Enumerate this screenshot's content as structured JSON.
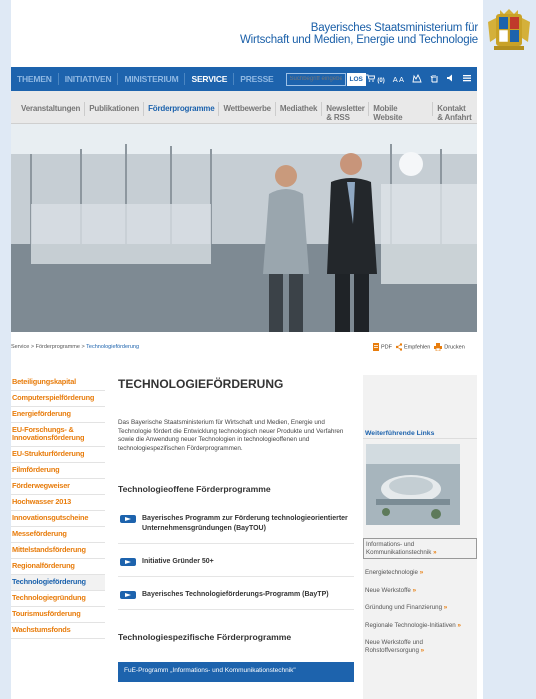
{
  "header": {
    "ministry_line1": "Bayerisches Staatsministerium für",
    "ministry_line2": "Wirtschaft und Medien, Energie und Technologie"
  },
  "topnav": {
    "items": [
      {
        "label": "THEMEN",
        "active": false
      },
      {
        "label": "INITIATIVEN",
        "active": false
      },
      {
        "label": "MINISTERIUM",
        "active": false
      },
      {
        "label": "SERVICE",
        "active": true
      },
      {
        "label": "PRESSE",
        "active": false
      }
    ],
    "search_placeholder": "Suchbegriff eingeben",
    "search_button": "LOS",
    "cart_count": "(0)",
    "font_size_label": "A A"
  },
  "subnav": {
    "items": [
      {
        "label": "Veranstaltungen",
        "active": false
      },
      {
        "label": "Publikationen",
        "active": false
      },
      {
        "label": "Förderprogramme",
        "active": true
      },
      {
        "label": "Wettbewerbe",
        "active": false
      },
      {
        "label": "Mediathek",
        "active": false
      },
      {
        "label": "Newsletter & RSS",
        "active": false
      },
      {
        "label": "Mobile Website",
        "active": false
      },
      {
        "label": "Kontakt & Anfahrt",
        "active": false
      }
    ]
  },
  "breadcrumb": {
    "items": [
      "Service",
      "Förderprogramme"
    ],
    "separator": ">",
    "current": "Technologieförderung"
  },
  "actions": {
    "pdf": "PDF",
    "recommend": "Empfehlen",
    "print": "Drucken"
  },
  "leftnav": {
    "items": [
      {
        "label": "Beteiligungskapital",
        "active": false
      },
      {
        "label": "Computerspielförderung",
        "active": false
      },
      {
        "label": "Energieförderung",
        "active": false
      },
      {
        "label": "EU-Forschungs- & Innovationsförderung",
        "active": false
      },
      {
        "label": "EU-Strukturförderung",
        "active": false
      },
      {
        "label": "Filmförderung",
        "active": false
      },
      {
        "label": "Förderwegweiser",
        "active": false
      },
      {
        "label": "Hochwasser 2013",
        "active": false
      },
      {
        "label": "Innovationsgutscheine",
        "active": false
      },
      {
        "label": "Messeförderung",
        "active": false
      },
      {
        "label": "Mittelstandsförderung",
        "active": false
      },
      {
        "label": "Regionalförderung",
        "active": false
      },
      {
        "label": "Technologieförderung",
        "active": true
      },
      {
        "label": "Technologiegründung",
        "active": false
      },
      {
        "label": "Tourismusförderung",
        "active": false
      },
      {
        "label": "Wachstumsfonds",
        "active": false
      }
    ]
  },
  "main": {
    "title": "TECHNOLOGIEFÖRDERUNG",
    "intro": "Das Bayerische Staatsministerium für Wirtschaft und Medien, Energie und Technologie fördert die Entwicklung technologisch neuer Produkte und Verfahren sowie die Anwendung neuer Technologien in technologieoffenen und technologiespezifischen Förderprogrammen.",
    "section1_title": "Technologieoffene Förderprogramme",
    "section1_items": [
      "Bayerisches Programm zur Förderung technologieorientierter Unternehmensgründungen (BayTOU)",
      "Initiative Gründer 50+",
      "Bayerisches Technologieförderungs-Programm (BayTP)"
    ],
    "section2_title": "Technologiespezifische Förderprogramme",
    "section2_first": "FuE-Programm „Informations- und Kommunikationstechnik\""
  },
  "right": {
    "title": "Weiterführende Links",
    "links": [
      {
        "label": "Informations- und Kommunikationstechnik",
        "boxed": true
      },
      {
        "label": "Energietechnologie",
        "boxed": false
      },
      {
        "label": "Neue Werkstoffe",
        "boxed": false
      },
      {
        "label": "Gründung und Finanzierung",
        "boxed": false
      },
      {
        "label": "Regionale Technologie-Initiativen",
        "boxed": false
      },
      {
        "label": "Neue Werkstoffe und Rohstoffversorgung",
        "boxed": false
      }
    ],
    "arrow": "»"
  },
  "colors": {
    "brand_blue": "#1d63ad",
    "accent_orange": "#e87d0d"
  }
}
